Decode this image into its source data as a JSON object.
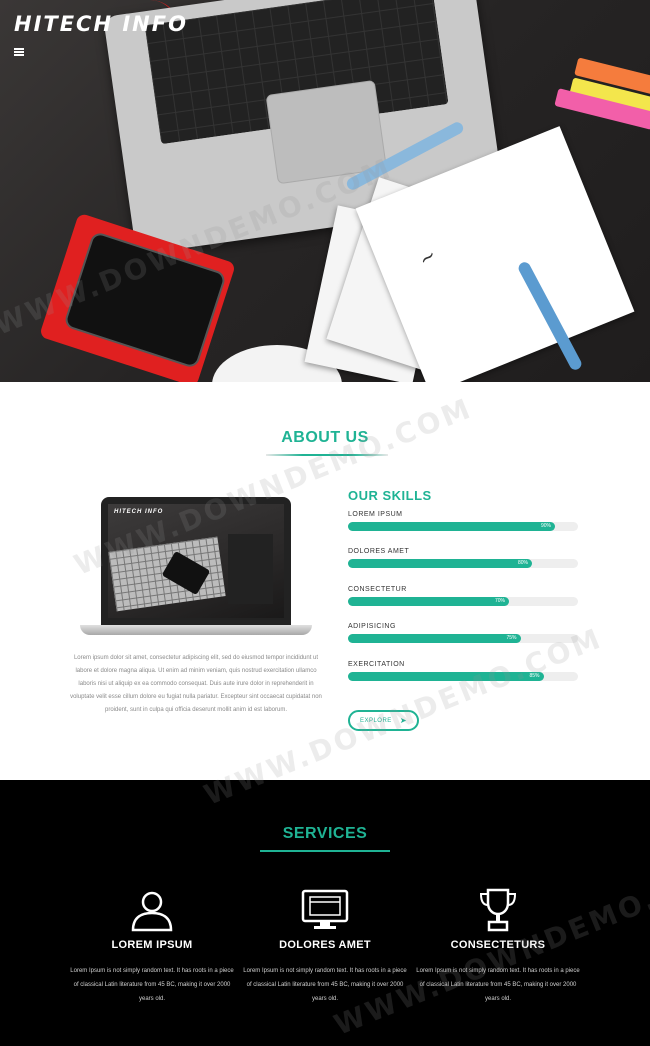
{
  "header": {
    "logo": "HITECH INFO",
    "menu_icon": "hamburger-icon"
  },
  "about": {
    "title": "ABOUT US",
    "mockup_logo": "HITECH INFO",
    "text": "Lorem ipsum dolor sit amet, consectetur adipiscing elit, sed do eiusmod tempor incididunt ut labore et dolore magna aliqua. Ut enim ad minim veniam, quis nostrud exercitation ullamco laboris nisi ut aliquip ex ea commodo consequat. Duis aute irure dolor in reprehenderit in voluptate velit esse cillum dolore eu fugiat nulla pariatur. Excepteur sint occaecat cupidatat non proident, sunt in culpa qui officia deserunt mollit anim id est laborum.",
    "skills_title": "OUR SKILLS",
    "skills": [
      {
        "label": "LOREM IPSUM",
        "percent": 90,
        "percent_label": "90%"
      },
      {
        "label": "DOLORES AMET",
        "percent": 80,
        "percent_label": "80%"
      },
      {
        "label": "CONSECTETUR",
        "percent": 70,
        "percent_label": "70%"
      },
      {
        "label": "ADIPISICING",
        "percent": 75,
        "percent_label": "75%"
      },
      {
        "label": "EXERCITATION",
        "percent": 85,
        "percent_label": "85%"
      }
    ],
    "explore_label": "EXPLORE"
  },
  "services": {
    "title": "SERVICES",
    "items": [
      {
        "icon": "user-icon",
        "name": "LOREM IPSUM",
        "desc": "Lorem Ipsum is not simply random text. It has roots in a piece of classical Latin literature from 45 BC, making it over 2000 years old."
      },
      {
        "icon": "monitor-icon",
        "name": "DOLORES AMET",
        "desc": "Lorem Ipsum is not simply random text. It has roots in a piece of classical Latin literature from 45 BC, making it over 2000 years old."
      },
      {
        "icon": "trophy-icon",
        "name": "CONSECTETURS",
        "desc": "Lorem Ipsum is not simply random text. It has roots in a piece of classical Latin literature from 45 BC, making it over 2000 years old."
      }
    ]
  },
  "watermark": "WWW.DOWNDEMO.COM",
  "colors": {
    "accent": "#1fb394",
    "hero_bg": "#2a2828",
    "services_bg": "#000000"
  }
}
